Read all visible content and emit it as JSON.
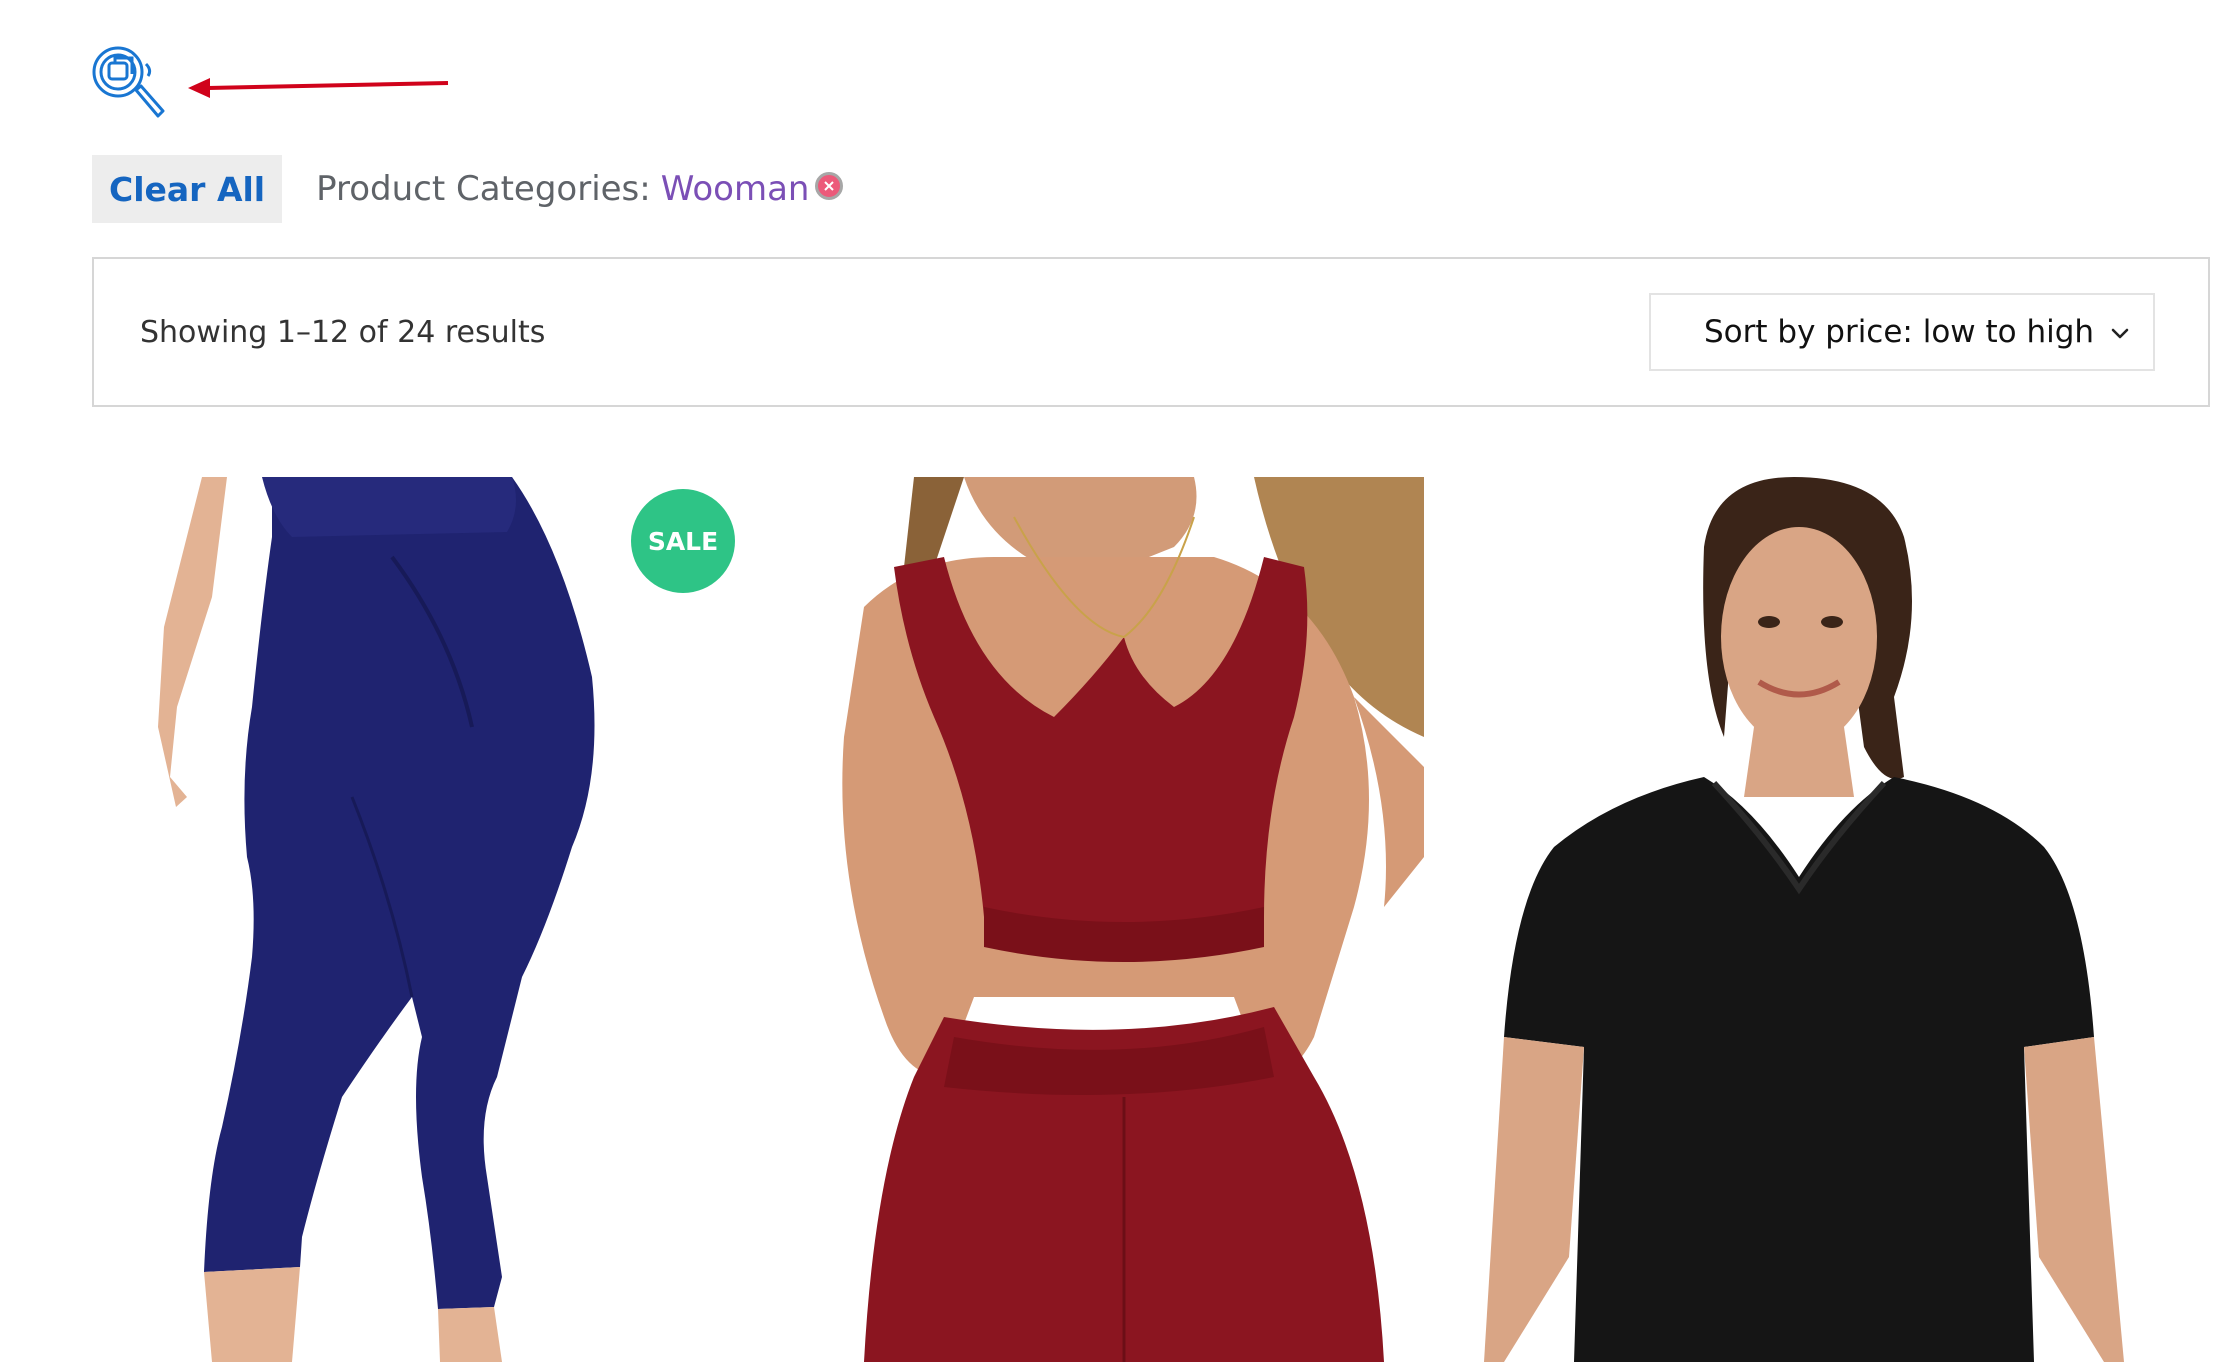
{
  "filters": {
    "clear_all_label": "Clear All",
    "active": [
      {
        "label": "Product Categories:",
        "value": "Wooman"
      }
    ]
  },
  "toolbar": {
    "result_count": "Showing 1–12 of 24 results",
    "sort": {
      "selected": "Sort by price: low to high"
    }
  },
  "products": [
    {
      "image": "navy capri leggings",
      "badge": "SALE"
    },
    {
      "image": "burgundy ribbed sports bra set"
    },
    {
      "image": "black v-neck t-shirt"
    }
  ],
  "colors": {
    "clear_all_text": "#1565c0",
    "filter_value": "#7b4fb6",
    "sale_badge": "#2ec486",
    "annotation_arrow": "#d0021b",
    "filter_icon": "#1976d2"
  },
  "icons": [
    "filter-search-icon",
    "close-circle-icon",
    "chevron-down-icon"
  ]
}
